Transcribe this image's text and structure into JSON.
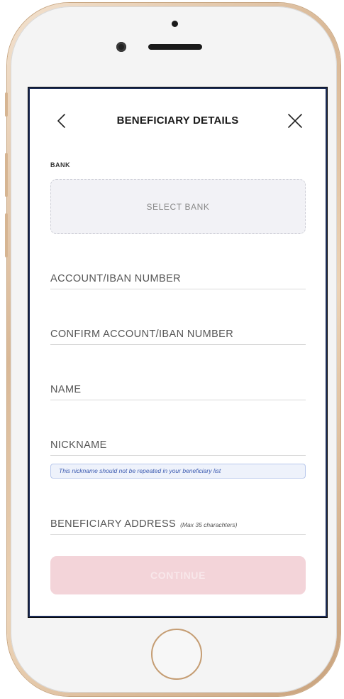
{
  "header": {
    "title": "BENEFICIARY DETAILS",
    "back_icon": "chevron-left-icon",
    "close_icon": "close-icon"
  },
  "bank": {
    "label": "BANK",
    "select_label": "SELECT BANK"
  },
  "fields": {
    "account_number": {
      "label": "ACCOUNT/IBAN NUMBER"
    },
    "confirm_account_number": {
      "label": "CONFIRM ACCOUNT/IBAN NUMBER"
    },
    "name": {
      "label": "NAME"
    },
    "nickname": {
      "label": "NICKNAME",
      "hint": "This nickname should not be repeated in your beneficiary list"
    },
    "beneficiary_address": {
      "label": "BENEFICIARY ADDRESS",
      "sublabel": "(Max 35 charachters)"
    }
  },
  "actions": {
    "continue_label": "CONTINUE"
  },
  "colors": {
    "screen_border": "#1b2b55",
    "continue_button_bg": "#f3d4d9",
    "hint_bg": "#eef2fb",
    "hint_text": "#3b5ab0",
    "select_bank_bg": "#f2f2f6",
    "phone_frame": "#d9b896"
  }
}
